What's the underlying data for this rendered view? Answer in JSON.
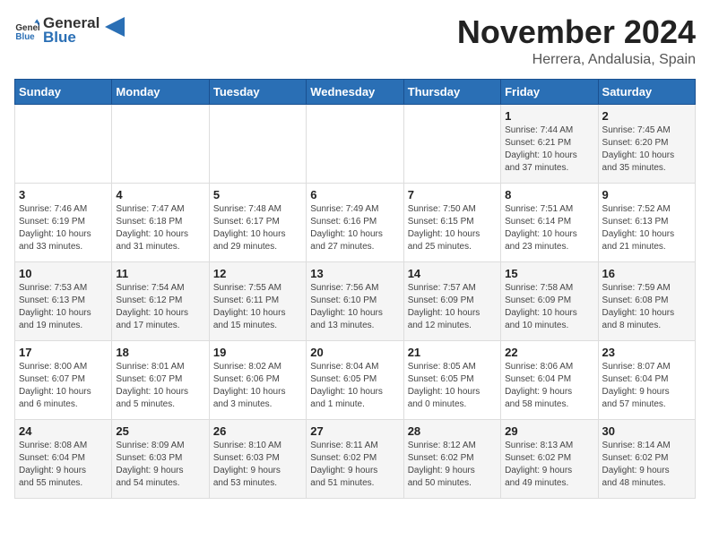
{
  "header": {
    "logo_general": "General",
    "logo_blue": "Blue",
    "month_title": "November 2024",
    "location": "Herrera, Andalusia, Spain"
  },
  "calendar": {
    "days_of_week": [
      "Sunday",
      "Monday",
      "Tuesday",
      "Wednesday",
      "Thursday",
      "Friday",
      "Saturday"
    ],
    "weeks": [
      [
        {
          "day": "",
          "info": ""
        },
        {
          "day": "",
          "info": ""
        },
        {
          "day": "",
          "info": ""
        },
        {
          "day": "",
          "info": ""
        },
        {
          "day": "",
          "info": ""
        },
        {
          "day": "1",
          "info": "Sunrise: 7:44 AM\nSunset: 6:21 PM\nDaylight: 10 hours\nand 37 minutes."
        },
        {
          "day": "2",
          "info": "Sunrise: 7:45 AM\nSunset: 6:20 PM\nDaylight: 10 hours\nand 35 minutes."
        }
      ],
      [
        {
          "day": "3",
          "info": "Sunrise: 7:46 AM\nSunset: 6:19 PM\nDaylight: 10 hours\nand 33 minutes."
        },
        {
          "day": "4",
          "info": "Sunrise: 7:47 AM\nSunset: 6:18 PM\nDaylight: 10 hours\nand 31 minutes."
        },
        {
          "day": "5",
          "info": "Sunrise: 7:48 AM\nSunset: 6:17 PM\nDaylight: 10 hours\nand 29 minutes."
        },
        {
          "day": "6",
          "info": "Sunrise: 7:49 AM\nSunset: 6:16 PM\nDaylight: 10 hours\nand 27 minutes."
        },
        {
          "day": "7",
          "info": "Sunrise: 7:50 AM\nSunset: 6:15 PM\nDaylight: 10 hours\nand 25 minutes."
        },
        {
          "day": "8",
          "info": "Sunrise: 7:51 AM\nSunset: 6:14 PM\nDaylight: 10 hours\nand 23 minutes."
        },
        {
          "day": "9",
          "info": "Sunrise: 7:52 AM\nSunset: 6:13 PM\nDaylight: 10 hours\nand 21 minutes."
        }
      ],
      [
        {
          "day": "10",
          "info": "Sunrise: 7:53 AM\nSunset: 6:13 PM\nDaylight: 10 hours\nand 19 minutes."
        },
        {
          "day": "11",
          "info": "Sunrise: 7:54 AM\nSunset: 6:12 PM\nDaylight: 10 hours\nand 17 minutes."
        },
        {
          "day": "12",
          "info": "Sunrise: 7:55 AM\nSunset: 6:11 PM\nDaylight: 10 hours\nand 15 minutes."
        },
        {
          "day": "13",
          "info": "Sunrise: 7:56 AM\nSunset: 6:10 PM\nDaylight: 10 hours\nand 13 minutes."
        },
        {
          "day": "14",
          "info": "Sunrise: 7:57 AM\nSunset: 6:09 PM\nDaylight: 10 hours\nand 12 minutes."
        },
        {
          "day": "15",
          "info": "Sunrise: 7:58 AM\nSunset: 6:09 PM\nDaylight: 10 hours\nand 10 minutes."
        },
        {
          "day": "16",
          "info": "Sunrise: 7:59 AM\nSunset: 6:08 PM\nDaylight: 10 hours\nand 8 minutes."
        }
      ],
      [
        {
          "day": "17",
          "info": "Sunrise: 8:00 AM\nSunset: 6:07 PM\nDaylight: 10 hours\nand 6 minutes."
        },
        {
          "day": "18",
          "info": "Sunrise: 8:01 AM\nSunset: 6:07 PM\nDaylight: 10 hours\nand 5 minutes."
        },
        {
          "day": "19",
          "info": "Sunrise: 8:02 AM\nSunset: 6:06 PM\nDaylight: 10 hours\nand 3 minutes."
        },
        {
          "day": "20",
          "info": "Sunrise: 8:04 AM\nSunset: 6:05 PM\nDaylight: 10 hours\nand 1 minute."
        },
        {
          "day": "21",
          "info": "Sunrise: 8:05 AM\nSunset: 6:05 PM\nDaylight: 10 hours\nand 0 minutes."
        },
        {
          "day": "22",
          "info": "Sunrise: 8:06 AM\nSunset: 6:04 PM\nDaylight: 9 hours\nand 58 minutes."
        },
        {
          "day": "23",
          "info": "Sunrise: 8:07 AM\nSunset: 6:04 PM\nDaylight: 9 hours\nand 57 minutes."
        }
      ],
      [
        {
          "day": "24",
          "info": "Sunrise: 8:08 AM\nSunset: 6:04 PM\nDaylight: 9 hours\nand 55 minutes."
        },
        {
          "day": "25",
          "info": "Sunrise: 8:09 AM\nSunset: 6:03 PM\nDaylight: 9 hours\nand 54 minutes."
        },
        {
          "day": "26",
          "info": "Sunrise: 8:10 AM\nSunset: 6:03 PM\nDaylight: 9 hours\nand 53 minutes."
        },
        {
          "day": "27",
          "info": "Sunrise: 8:11 AM\nSunset: 6:02 PM\nDaylight: 9 hours\nand 51 minutes."
        },
        {
          "day": "28",
          "info": "Sunrise: 8:12 AM\nSunset: 6:02 PM\nDaylight: 9 hours\nand 50 minutes."
        },
        {
          "day": "29",
          "info": "Sunrise: 8:13 AM\nSunset: 6:02 PM\nDaylight: 9 hours\nand 49 minutes."
        },
        {
          "day": "30",
          "info": "Sunrise: 8:14 AM\nSunset: 6:02 PM\nDaylight: 9 hours\nand 48 minutes."
        }
      ]
    ]
  }
}
